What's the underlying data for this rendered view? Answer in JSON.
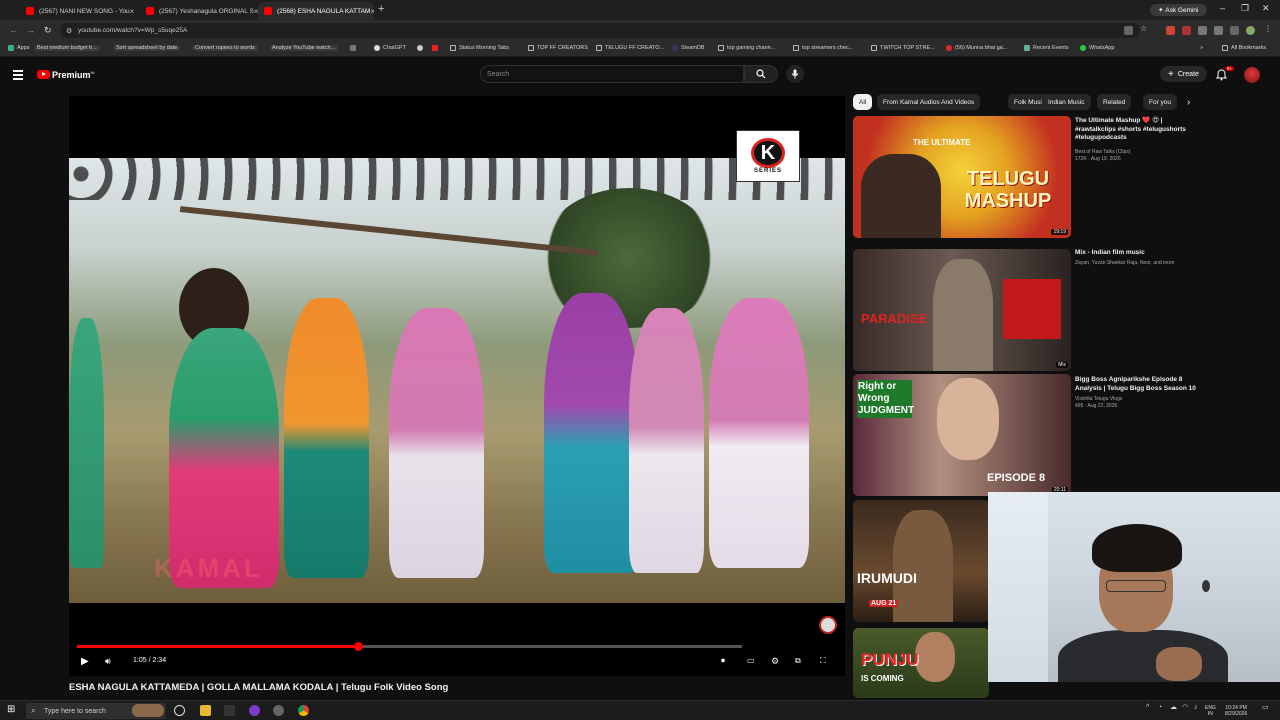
{
  "browser": {
    "tabs": [
      {
        "label": "(2567) NANI NEW SONG - You"
      },
      {
        "label": "(2567) Yeshanagula ORGINAL S"
      },
      {
        "label": "(2568) ESHA NAGULA KATTAM"
      }
    ],
    "ask_gemini": "Ask Gemini",
    "url": "youtube.com/watch?v=Wp_s5uqe25A",
    "bookmarks": [
      "Apps",
      "Best medium budget tr...",
      "Sort spreadsheet by date",
      "Convert rupees to words",
      "Analyze YouTube watch...",
      "ChatGPT",
      "Status Morning Tabs",
      "TOP FF CREATORS",
      "TELUGU FF CREATO...",
      "SteamDB",
      "top gaming chann...",
      "top streamers chec...",
      "TWITCH TOP STRE...",
      "(56) Munna bhai ga...",
      "Recent Events",
      "WhatsApp",
      "All Bookmarks"
    ]
  },
  "youtube": {
    "logo_text": "Premium",
    "logo_super": "IN",
    "search_placeholder": "Search",
    "create_label": "Create",
    "notif_count": "9+",
    "chips": [
      "All",
      "From Kamal Audios And Videos",
      "Folk Music",
      "Indian Music",
      "Related",
      "For you"
    ],
    "recommendations": [
      {
        "title": "The Ultimate Mashup ❤️ 😍 | #rawtalkclips #shorts #telugushorts #telugupodcasts",
        "channel": "Best of Raw Talks (Clips)",
        "stats": "172K · Aug 19, 2026",
        "duration": "19:19",
        "thumb_text": "TELUGU MASHUP",
        "thumb_text_top": "THE ULTIMATE"
      },
      {
        "title": "Mix - Indian film music",
        "channel": "Zayan, Yuvan Shankar Raja, Noor, and more",
        "stats": "",
        "duration": "Mix",
        "thumb_text": "PARADISE",
        "thumb_text_top": ""
      },
      {
        "title": "Bigg Boss Agniparikshe Episode 8 Analysis | Telugu Bigg Boss Season 10",
        "channel": "Visishta Telugu Vlogs",
        "stats": "495 · Aug 22, 2026",
        "duration": "20:11",
        "thumb_text": "EPISODE 8",
        "thumb_text_top": "Right or Wrong JUDGMENT"
      },
      {
        "title": "",
        "channel": "",
        "stats": "",
        "duration": "",
        "thumb_text": "IRUMUDI",
        "thumb_text_top": "AUG 21"
      },
      {
        "title": "",
        "channel": "",
        "stats": "",
        "duration": "",
        "thumb_text": "PUNJU",
        "thumb_text_top": "IS COMING"
      }
    ]
  },
  "video": {
    "time_current": "1:05",
    "time_total": "2:34",
    "progress": 0.4226,
    "loaded": 1.0,
    "title": "ESHA NAGULA KATTAMEDA | GOLLA MALLAMA KODALA | Telugu Folk Video Song",
    "logo_letter": "K",
    "logo_caption": "SERIES",
    "watermark": "KAMAL"
  },
  "taskbar": {
    "search_placeholder": "Type here to search",
    "lang": "ENG",
    "region": "IN",
    "time": "10:24 PM",
    "date": "8/29/2026"
  }
}
